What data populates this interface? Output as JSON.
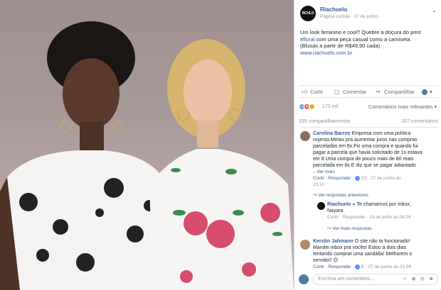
{
  "page": {
    "logo_text": "RCHLO",
    "name": "Riachuelo",
    "meta": "Página curtida · 27 de junho ·",
    "post_line1": "Um look feminino e cool? Quebre a doçura do print",
    "post_tag": "#floral",
    "post_line2": " com uma peça casual como a camiseta.",
    "post_line3": "(Blusas a partir de R$49,90 cada)",
    "post_link": "www.riachuelo.com.br"
  },
  "actions": {
    "like": "Curtir",
    "comment": "Comentar",
    "share": "Compartilhar"
  },
  "reactions": {
    "count": "172 mil",
    "sort": "Comentários mais relevantes ▾",
    "shares": "335 compartilhamentos",
    "comments_count": "267 comentários"
  },
  "comments": {
    "c1": {
      "name": "Carolina Barros",
      "l1": " Empresa com uma política",
      "l2": "nojenta.Metas pra aumentar juros nas compras",
      "l3": "parceladas em 8x.Fiz uma compra e quando fui",
      "l4": "pagar a parcela que havia solicitado de 1x estava",
      "l5": "em 8.Uma compra de pouco mais de 80 reais",
      "l6": "parcelada em 8x.E diz que se pagar adiantado",
      "more": "...Ver mais",
      "act": "Curtir · Responder ·",
      "time": " 23 · 27 de junho às",
      "time2": "23:11"
    },
    "c1_replies_prev": "↪ Ver respostas anteriores",
    "r1": {
      "name": "Riachuelo",
      "l1": " Te chamamos por inbox,",
      "l2": "Nayara",
      "act": "Curtir · Responder · 14 de julho às 08:34"
    },
    "c1_more_replies": "↪ Ver mais respostas",
    "c2": {
      "name": "Kerstin Jahmann",
      "l1": " O site não ta funcionado!",
      "l2": "Mandei inbox pra vocês! Estou a dois dias",
      "l3": "tentando comprar uma sandália! Melhorem o",
      "l4": "servido!! 😕",
      "act": "Curtir · Responder ·",
      "time": " 6 · 27 de junho às 21:06"
    }
  },
  "composer": {
    "placeholder": "Escreva um comentário...",
    "tools": "☺ ◉ ◍ ☻"
  },
  "colors": {
    "link": "#365899",
    "meta": "#90949c",
    "like_blue": "#5890ff",
    "love_red": "#f25268",
    "haha_yellow": "#fcd34d"
  }
}
